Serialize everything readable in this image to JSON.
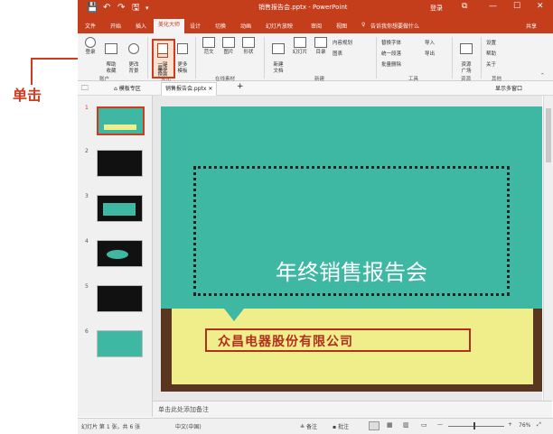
{
  "annotation": {
    "callout": "单击"
  },
  "titlebar": {
    "title": "销售报告会.pptx - PowerPoint",
    "quick_access": [
      "💾",
      "↶",
      "↷",
      "🖫",
      "▾"
    ],
    "user": "登录",
    "window_buttons": [
      "⧉",
      "—",
      "☐",
      "✕"
    ]
  },
  "menu": {
    "tabs": [
      "文件",
      "开始",
      "插入",
      "美化大师",
      "设计",
      "切换",
      "动画",
      "幻灯片放映",
      "审阅",
      "视图"
    ],
    "active_index": 3,
    "tell_me": "告诉我你想要做什么",
    "share": "共享"
  },
  "ribbon": {
    "account": {
      "btn1": "登录",
      "btn2": "帮助\n收藏",
      "btn3": "更改\n背景",
      "group": "账户"
    },
    "beautify": {
      "one_click": "一键\n美化",
      "more_templates": "更多\n模板",
      "btn_rebuild": "魔法\n换装",
      "group": "美化"
    },
    "materials": {
      "btn_template": "范文",
      "btn_picture": "图片",
      "btn_shape": "形状",
      "group": "在线素材"
    },
    "new": {
      "new_doc": "新建\n文档",
      "slides": "幻灯片",
      "toc": "目录",
      "content_plan": "内容规划",
      "charts": "图表",
      "group": "新建"
    },
    "tools": {
      "replace_font": "替换字体",
      "import": "导入",
      "uniform_style": "统一段落",
      "export": "导出",
      "batch_delete": "批量删除",
      "group": "工具"
    },
    "resources": {
      "label": "资源\n广场",
      "group": "资源"
    },
    "other": {
      "settings": "设置",
      "help": "帮助",
      "about": "关于",
      "group": "其他"
    }
  },
  "doctabs": {
    "template_tab": "模板专区",
    "file_tab": "销售报告会.pptx",
    "right": "显示多窗口"
  },
  "slides": [
    "1",
    "2",
    "3",
    "4",
    "5",
    "6"
  ],
  "slide": {
    "title": "年终销售报告会",
    "company": "众昌电器股份有限公司"
  },
  "notes": {
    "placeholder": "单击此处添加备注"
  },
  "status": {
    "slide_info": "幻灯片 第 1 张，共 6 张",
    "language": "中文(中国)",
    "notes_btn": "备注",
    "comments_btn": "批注",
    "zoom": "76%"
  },
  "colors": {
    "accent": "#c43e1c",
    "slide_teal": "#3eb8a3",
    "paper": "#f0ee8a",
    "highlight": "#d23a1e"
  }
}
